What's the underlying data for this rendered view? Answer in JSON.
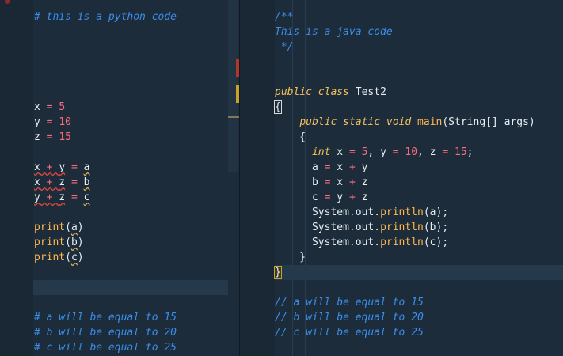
{
  "left_editor": {
    "lines": [
      [
        {
          "t": "# this is a python code",
          "c": "c-comment"
        }
      ],
      [],
      [],
      [],
      [],
      [],
      [
        {
          "t": "x",
          "c": "c-var"
        },
        {
          "t": " = ",
          "c": "c-op"
        },
        {
          "t": "5",
          "c": "c-num"
        }
      ],
      [
        {
          "t": "y",
          "c": "c-var"
        },
        {
          "t": " = ",
          "c": "c-op"
        },
        {
          "t": "10",
          "c": "c-num"
        }
      ],
      [
        {
          "t": "z",
          "c": "c-var"
        },
        {
          "t": " = ",
          "c": "c-op"
        },
        {
          "t": "15",
          "c": "c-num"
        }
      ],
      [],
      [
        {
          "t": "x",
          "c": "c-var squig"
        },
        {
          "t": " + ",
          "c": "c-op squig"
        },
        {
          "t": "y",
          "c": "c-var squig"
        },
        {
          "t": " = ",
          "c": "c-op"
        },
        {
          "t": "a",
          "c": "c-var squig-y"
        }
      ],
      [
        {
          "t": "x",
          "c": "c-var squig"
        },
        {
          "t": " + ",
          "c": "c-op squig"
        },
        {
          "t": "z",
          "c": "c-var squig"
        },
        {
          "t": " = ",
          "c": "c-op"
        },
        {
          "t": "b",
          "c": "c-var squig-y"
        }
      ],
      [
        {
          "t": "y",
          "c": "c-var squig"
        },
        {
          "t": " + ",
          "c": "c-op squig"
        },
        {
          "t": "z",
          "c": "c-var squig"
        },
        {
          "t": " = ",
          "c": "c-op"
        },
        {
          "t": "c",
          "c": "c-var squig-y"
        }
      ],
      [],
      [
        {
          "t": "print",
          "c": "c-fn"
        },
        {
          "t": "(",
          "c": "c-punc"
        },
        {
          "t": "a",
          "c": "c-var squig-y"
        },
        {
          "t": ")",
          "c": "c-punc"
        }
      ],
      [
        {
          "t": "print",
          "c": "c-fn"
        },
        {
          "t": "(",
          "c": "c-punc"
        },
        {
          "t": "b",
          "c": "c-var squig-y"
        },
        {
          "t": ")",
          "c": "c-punc"
        }
      ],
      [
        {
          "t": "print",
          "c": "c-fn"
        },
        {
          "t": "(",
          "c": "c-punc"
        },
        {
          "t": "c",
          "c": "c-var squig-y"
        },
        {
          "t": ")",
          "c": "c-punc"
        }
      ],
      [],
      [],
      [],
      [
        {
          "t": "# a will be equal to 15",
          "c": "c-comment"
        }
      ],
      [
        {
          "t": "# b will be equal to 20",
          "c": "c-comment"
        }
      ],
      [
        {
          "t": "# c will be equal to 25",
          "c": "c-comment"
        }
      ]
    ]
  },
  "right_editor": {
    "lines": [
      [
        {
          "t": "/**",
          "c": "c-comment"
        }
      ],
      [
        {
          "t": "This is a java code",
          "c": "c-comment"
        }
      ],
      [
        {
          "t": " */",
          "c": "c-comment"
        }
      ],
      [],
      [],
      [
        {
          "t": "public",
          "c": "c-kw"
        },
        {
          "t": " ",
          "c": "c-var"
        },
        {
          "t": "class",
          "c": "c-kw"
        },
        {
          "t": " Test2",
          "c": "c-class"
        }
      ],
      [
        {
          "t": "{",
          "c": "c-punc bracket-box"
        }
      ],
      [
        {
          "t": "    ",
          "c": "c-var"
        },
        {
          "t": "public",
          "c": "c-kw"
        },
        {
          "t": " ",
          "c": "c-var"
        },
        {
          "t": "static",
          "c": "c-kw"
        },
        {
          "t": " ",
          "c": "c-var"
        },
        {
          "t": "void",
          "c": "c-kw"
        },
        {
          "t": " main",
          "c": "c-fn"
        },
        {
          "t": "(String[] args)",
          "c": "c-punc"
        }
      ],
      [
        {
          "t": "    {",
          "c": "c-punc"
        }
      ],
      [
        {
          "t": "      ",
          "c": "c-var"
        },
        {
          "t": "int",
          "c": "c-kw"
        },
        {
          "t": " x ",
          "c": "c-var"
        },
        {
          "t": "=",
          "c": "c-op"
        },
        {
          "t": " ",
          "c": "c-var"
        },
        {
          "t": "5",
          "c": "c-num"
        },
        {
          "t": ", y ",
          "c": "c-var"
        },
        {
          "t": "=",
          "c": "c-op"
        },
        {
          "t": " ",
          "c": "c-var"
        },
        {
          "t": "10",
          "c": "c-num"
        },
        {
          "t": ", z ",
          "c": "c-var"
        },
        {
          "t": "=",
          "c": "c-op"
        },
        {
          "t": " ",
          "c": "c-var"
        },
        {
          "t": "15",
          "c": "c-num"
        },
        {
          "t": ";",
          "c": "c-punc"
        }
      ],
      [
        {
          "t": "      a ",
          "c": "c-var"
        },
        {
          "t": "=",
          "c": "c-op"
        },
        {
          "t": " x ",
          "c": "c-var"
        },
        {
          "t": "+",
          "c": "c-op"
        },
        {
          "t": " y",
          "c": "c-var"
        }
      ],
      [
        {
          "t": "      b ",
          "c": "c-var"
        },
        {
          "t": "=",
          "c": "c-op"
        },
        {
          "t": " x ",
          "c": "c-var"
        },
        {
          "t": "+",
          "c": "c-op"
        },
        {
          "t": " z",
          "c": "c-var"
        }
      ],
      [
        {
          "t": "      c ",
          "c": "c-var"
        },
        {
          "t": "=",
          "c": "c-op"
        },
        {
          "t": " y ",
          "c": "c-var"
        },
        {
          "t": "+",
          "c": "c-op"
        },
        {
          "t": " z",
          "c": "c-var"
        }
      ],
      [
        {
          "t": "      System.out.",
          "c": "c-var"
        },
        {
          "t": "println",
          "c": "c-fn"
        },
        {
          "t": "(a);",
          "c": "c-punc"
        }
      ],
      [
        {
          "t": "      System.out.",
          "c": "c-var"
        },
        {
          "t": "println",
          "c": "c-fn"
        },
        {
          "t": "(b);",
          "c": "c-punc"
        }
      ],
      [
        {
          "t": "      System.out.",
          "c": "c-var"
        },
        {
          "t": "println",
          "c": "c-fn"
        },
        {
          "t": "(c);",
          "c": "c-punc"
        }
      ],
      [
        {
          "t": "    }",
          "c": "c-punc"
        }
      ],
      [
        {
          "t": "}",
          "c": "c-punc bracket-box-y"
        }
      ],
      [],
      [
        {
          "t": "// a will be equal to 15",
          "c": "c-comment"
        }
      ],
      [
        {
          "t": "// b will be equal to 20",
          "c": "c-comment"
        }
      ],
      [
        {
          "t": "// c will be equal to 25",
          "c": "c-comment"
        }
      ]
    ]
  },
  "colors": {
    "background": "#1c2c3b",
    "comment": "#3b8eea",
    "keyword": "#f5c05c",
    "operator": "#ff6b7d",
    "function": "#ffb74d",
    "error_squiggle": "#e0483e",
    "warning_squiggle": "#e8b84a"
  }
}
